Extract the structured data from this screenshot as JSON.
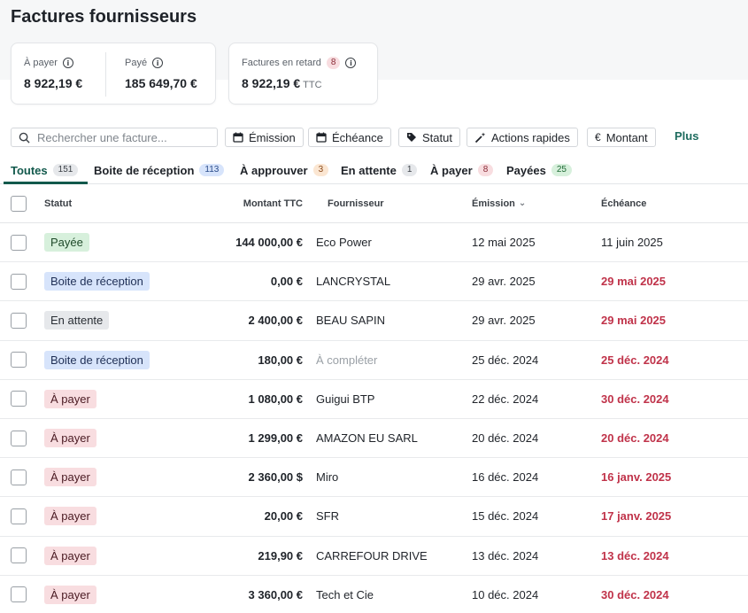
{
  "page": {
    "title": "Factures fournisseurs"
  },
  "summary": {
    "to_pay": {
      "label": "À payer",
      "value": "8 922,19 €"
    },
    "paid": {
      "label": "Payé",
      "value": "185 649,70 €"
    },
    "late": {
      "label": "Factures en retard",
      "count": "8",
      "value": "8 922,19 €",
      "suffix": "TTC"
    }
  },
  "toolbar": {
    "search_placeholder": "Rechercher une facture...",
    "filters": {
      "emission": "Émission",
      "echeance": "Échéance",
      "statut": "Statut",
      "actions": "Actions rapides",
      "montant": "Montant"
    },
    "more": "Plus"
  },
  "tabs": [
    {
      "label": "Toutes",
      "count": "151"
    },
    {
      "label": "Boite de réception",
      "count": "113"
    },
    {
      "label": "À approuver",
      "count": "3"
    },
    {
      "label": "En attente",
      "count": "1"
    },
    {
      "label": "À payer",
      "count": "8"
    },
    {
      "label": "Payées",
      "count": "25"
    }
  ],
  "table": {
    "headers": {
      "statut": "Statut",
      "montant": "Montant TTC",
      "fournisseur": "Fournisseur",
      "emission": "Émission",
      "echeance": "Échéance"
    },
    "rows": [
      {
        "statut": "Payée",
        "montant": "144 000,00 €",
        "fournisseur": "Eco Power",
        "emission": "12 mai 2025",
        "echeance": "11 juin 2025"
      },
      {
        "statut": "Boite de réception",
        "montant": "0,00 €",
        "fournisseur": "LANCRYSTAL",
        "emission": "29 avr. 2025",
        "echeance": "29 mai 2025"
      },
      {
        "statut": "En attente",
        "montant": "2 400,00 €",
        "fournisseur": "BEAU SAPIN",
        "emission": "29 avr. 2025",
        "echeance": "29 mai 2025"
      },
      {
        "statut": "Boite de réception",
        "montant": "180,00 €",
        "fournisseur": "À compléter",
        "emission": "25 déc. 2024",
        "echeance": "25 déc. 2024"
      },
      {
        "statut": "À payer",
        "montant": "1 080,00 €",
        "fournisseur": "Guigui BTP",
        "emission": "22 déc. 2024",
        "echeance": "30 déc. 2024"
      },
      {
        "statut": "À payer",
        "montant": "1 299,00 €",
        "fournisseur": "AMAZON EU SARL",
        "emission": "20 déc. 2024",
        "echeance": "20 déc. 2024"
      },
      {
        "statut": "À payer",
        "montant": "2 360,00 $",
        "fournisseur": "Miro",
        "emission": "16 déc. 2024",
        "echeance": "16 janv. 2025"
      },
      {
        "statut": "À payer",
        "montant": "20,00 €",
        "fournisseur": "SFR",
        "emission": "15 déc. 2024",
        "echeance": "17 janv. 2025"
      },
      {
        "statut": "À payer",
        "montant": "219,90 €",
        "fournisseur": "CARREFOUR DRIVE",
        "emission": "13 déc. 2024",
        "echeance": "13 déc. 2024"
      },
      {
        "statut": "À payer",
        "montant": "3 360,00 €",
        "fournisseur": "Tech et Cie",
        "emission": "10 déc. 2024",
        "echeance": "30 déc. 2024"
      }
    ]
  },
  "colors": {
    "accent": "#12594c",
    "late": "#c0334a"
  }
}
